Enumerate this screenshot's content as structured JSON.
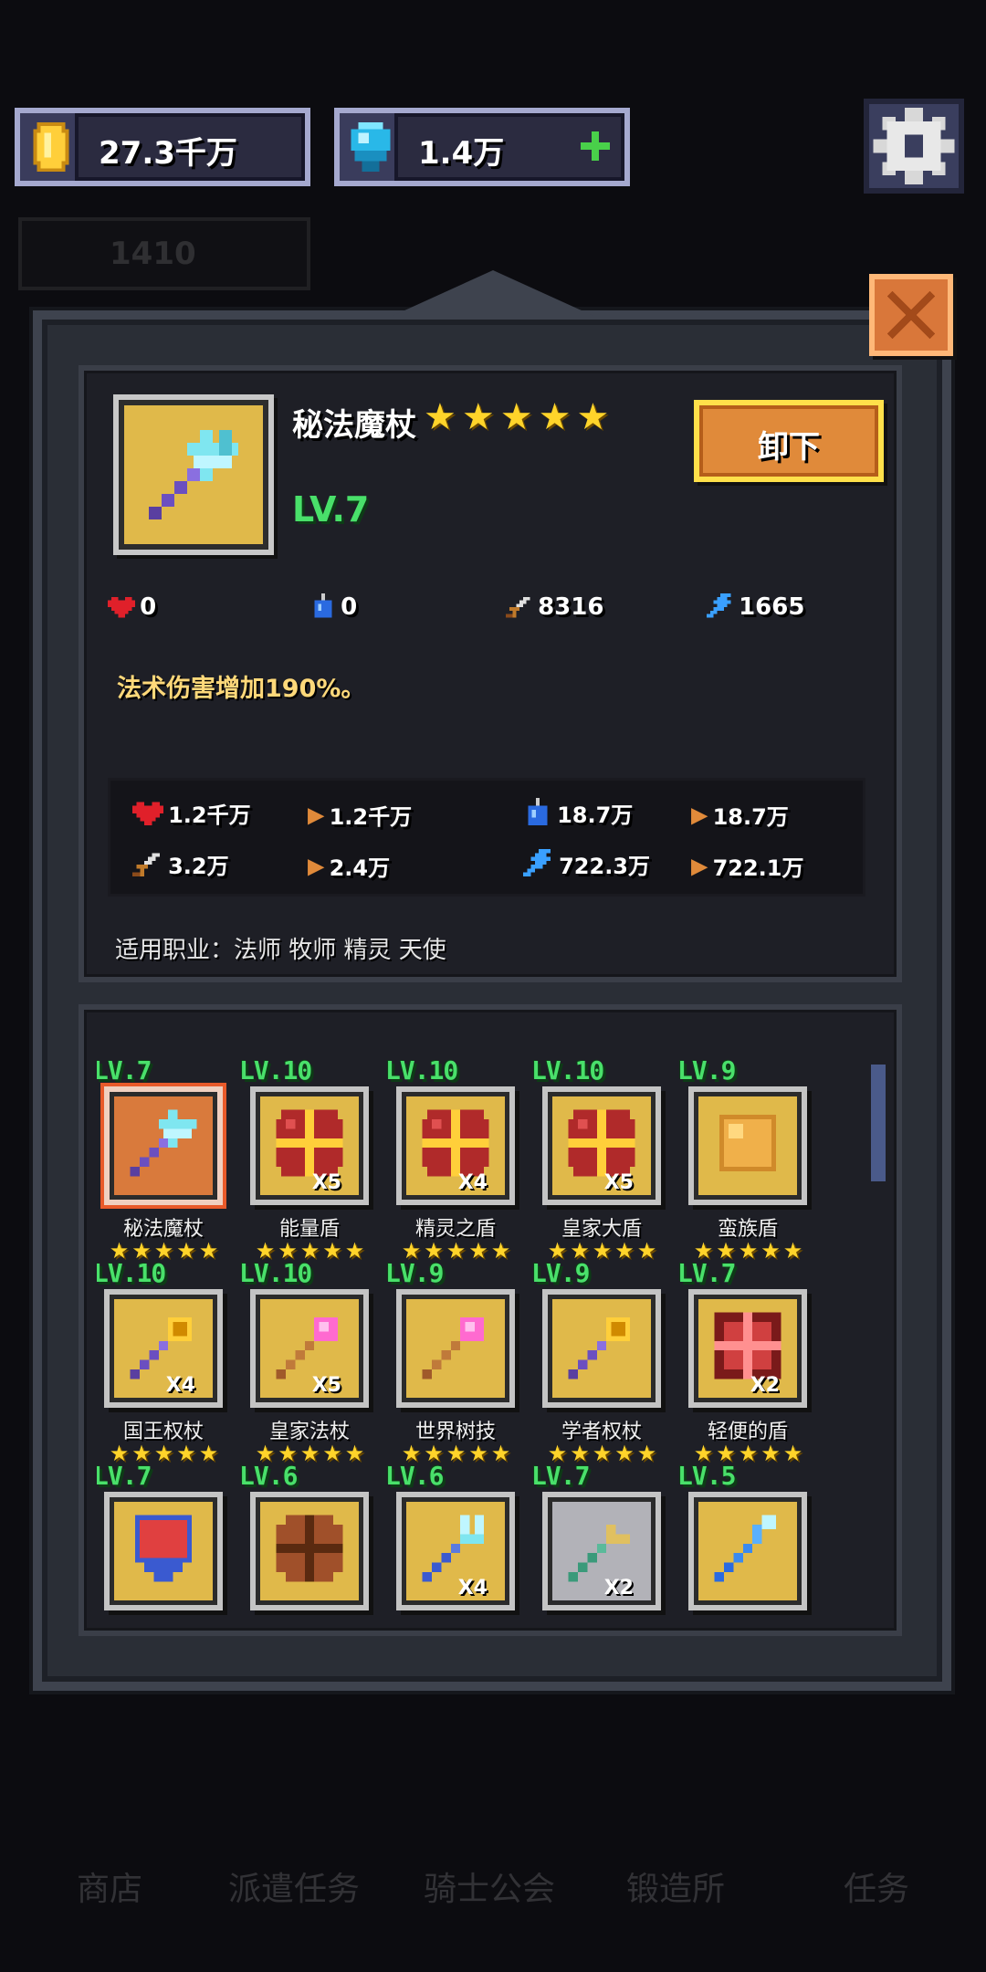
{
  "currency": {
    "gold": "27.3千万",
    "gems": "1.4万",
    "power_faded": "1410"
  },
  "item": {
    "name": "秘法魔杖",
    "stars": 5,
    "level": "LV.7",
    "unequip_label": "卸下",
    "stats": [
      {
        "icon": "heart-icon",
        "value": "0"
      },
      {
        "icon": "mana-potion-icon",
        "value": "0"
      },
      {
        "icon": "sword-icon",
        "value": "8316"
      },
      {
        "icon": "lightning-icon",
        "value": "1665"
      }
    ],
    "description": "法术伤害增加190%。",
    "totals": [
      {
        "icon": "heart-icon",
        "value": "1.2千万",
        "sub": "1.2千万"
      },
      {
        "icon": "mana-potion-icon",
        "value": "18.7万",
        "sub": "18.7万"
      },
      {
        "icon": "sword-icon",
        "value": "3.2万",
        "sub": "2.4万"
      },
      {
        "icon": "lightning-icon",
        "value": "722.3万",
        "sub": "722.1万"
      }
    ],
    "classes": "适用职业：法师 牧师 精灵 天使"
  },
  "grid": [
    {
      "level": "LV.7",
      "name": "秘法魔杖",
      "count": "",
      "icon": "arcane-staff-icon",
      "selected": true
    },
    {
      "level": "LV.10",
      "name": "能量盾",
      "count": "X5",
      "icon": "cross-shield-icon"
    },
    {
      "level": "LV.10",
      "name": "精灵之盾",
      "count": "X4",
      "icon": "cross-shield-icon"
    },
    {
      "level": "LV.10",
      "name": "皇家大盾",
      "count": "X5",
      "icon": "cross-shield-icon"
    },
    {
      "level": "LV.9",
      "name": "蛮族盾",
      "count": "",
      "icon": "barbarian-shield-icon"
    },
    {
      "level": "LV.10",
      "name": "国王权杖",
      "count": "X4",
      "icon": "scepter-icon"
    },
    {
      "level": "LV.10",
      "name": "皇家法杖",
      "count": "X5",
      "icon": "pink-staff-icon"
    },
    {
      "level": "LV.9",
      "name": "世界树技",
      "count": "",
      "icon": "pink-staff-icon"
    },
    {
      "level": "LV.9",
      "name": "学者权杖",
      "count": "",
      "icon": "scepter-icon"
    },
    {
      "level": "LV.7",
      "name": "轻便的盾",
      "count": "X2",
      "icon": "red-shield-icon"
    },
    {
      "level": "LV.7",
      "name": "",
      "count": "",
      "icon": "red-kite-shield-icon"
    },
    {
      "level": "LV.6",
      "name": "",
      "count": "",
      "icon": "round-shield-icon"
    },
    {
      "level": "LV.6",
      "name": "",
      "count": "X4",
      "icon": "trident-icon"
    },
    {
      "level": "LV.7",
      "name": "",
      "count": "X2",
      "icon": "forked-staff-icon",
      "grey": true
    },
    {
      "level": "LV.5",
      "name": "",
      "count": "",
      "icon": "blue-wand-icon"
    }
  ],
  "nav_faded": [
    "商店",
    "派遣任务",
    "骑士公会",
    "锻造所",
    "任务"
  ],
  "colors": {
    "gold": "#ffd42a",
    "level_green": "#49e06a",
    "accent_orange": "#e08a3a"
  }
}
